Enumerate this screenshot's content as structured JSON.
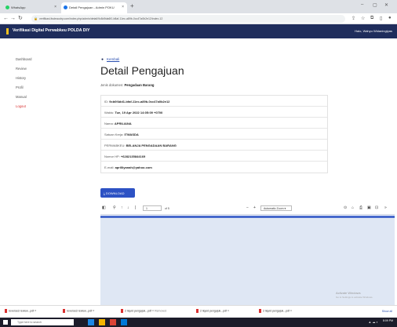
{
  "browser": {
    "tabs": [
      {
        "title": "WhatsApp",
        "favicon_color": "#25d366"
      },
      {
        "title": "Detail Pengajuan - Admin POKU",
        "favicon_color": "#1a73e8"
      }
    ],
    "url": "verifikasi.itsdeaudry.com/index.php/admin/detail/9c8d9da6f1-b8af-11ec-a89b-0cc47a0b2e12/index-12"
  },
  "app": {
    "title": "Verifikasi Digital Perwabkeu POLDA DIY",
    "user": "Halo, Wahyu Widaningtyas"
  },
  "sidebar": {
    "items": [
      {
        "label": "Dashboard"
      },
      {
        "label": "Review"
      },
      {
        "label": "History"
      },
      {
        "label": "Profil"
      },
      {
        "label": "Manual"
      },
      {
        "label": "Logout"
      }
    ]
  },
  "main": {
    "back_label": "Kembali",
    "title": "Detail Pengajuan",
    "doc_type_label": "Jenis dokumen:",
    "doc_type_value": "Pengadaan Barang",
    "details": [
      {
        "label": "ID:",
        "value": "9cb0f4dd1-bfaf-11ec-a89b-0cc47a0b2e12"
      },
      {
        "label": "Waktu:",
        "value": "Tue, 19 Apr 2022 14:05:09 +0700"
      },
      {
        "label": "Nama:",
        "value": "APRILIANA"
      },
      {
        "label": "Satuan Kerja:",
        "value": "ITWASDA"
      },
      {
        "label": "PERWABKEU:",
        "value": "BELANJA PENGADAAN BARANG"
      },
      {
        "label": "Nomor HP:",
        "value": "+6282135844169"
      },
      {
        "label": "E-mail:",
        "value": "aprilliyanah@yahoo.com"
      }
    ],
    "download_label": "DOWNLOAD"
  },
  "pdf_viewer": {
    "page_value": "1",
    "page_total": "of 5",
    "zoom_value": "Automatic Zoom"
  },
  "watermark": {
    "title": "Activate Windows",
    "subtitle": "Go to Settings to activate Windows."
  },
  "downloads": {
    "items": [
      {
        "name": "reverse3 review...pdf"
      },
      {
        "name": "reverse3 review...pdf"
      },
      {
        "name": "2 liquid pengajuk...pdf",
        "status": "Removed"
      },
      {
        "name": "2 liquid pengajuk...pdf"
      },
      {
        "name": "2 liquid pengajuk...pdf"
      }
    ],
    "show_all": "Show all"
  },
  "taskbar": {
    "search_placeholder": "Type here to search",
    "time": "8:09 PM"
  },
  "colors": {
    "appbar": "#1f2d5c",
    "accent": "#2d52c4",
    "logout": "#d83030"
  }
}
